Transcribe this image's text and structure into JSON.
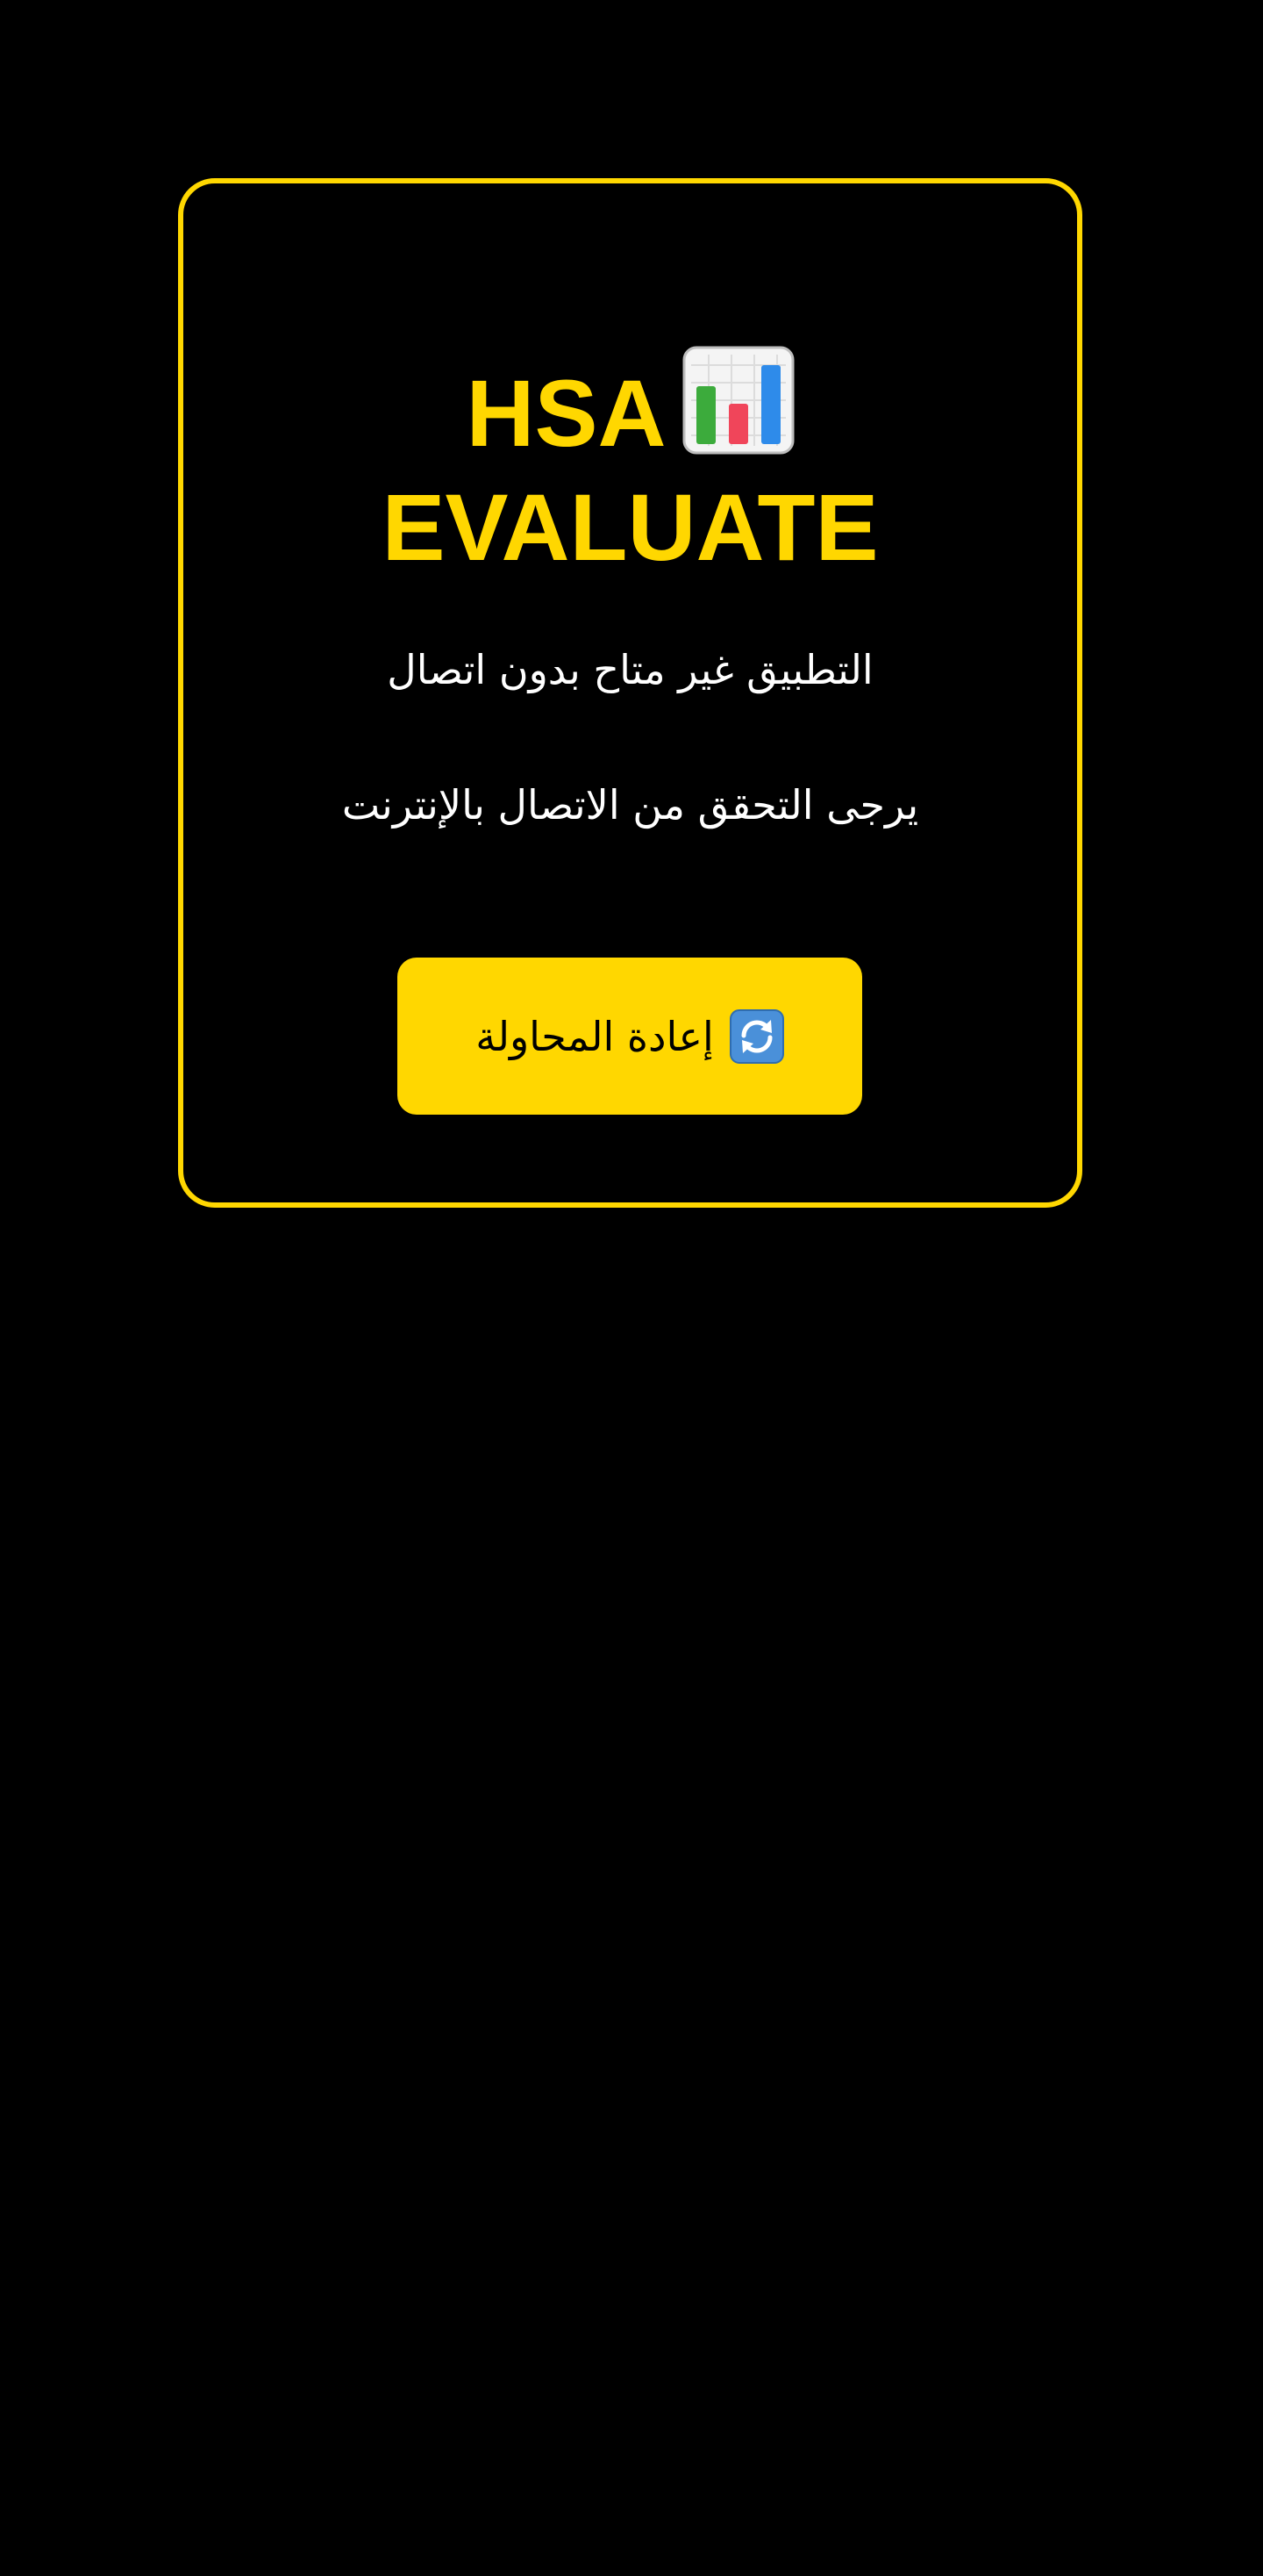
{
  "app": {
    "title_line1": "HSA",
    "title_line2": "EVALUATE",
    "title_icon": "bar-chart-icon"
  },
  "offline": {
    "message": "التطبيق غير متاح بدون اتصال",
    "hint": "يرجى التحقق من الاتصال بالإنترنت"
  },
  "retry": {
    "label": "إعادة المحاولة",
    "icon": "refresh-icon"
  },
  "colors": {
    "background": "#000000",
    "accent": "#FFD700",
    "text": "#FFFFFF"
  }
}
